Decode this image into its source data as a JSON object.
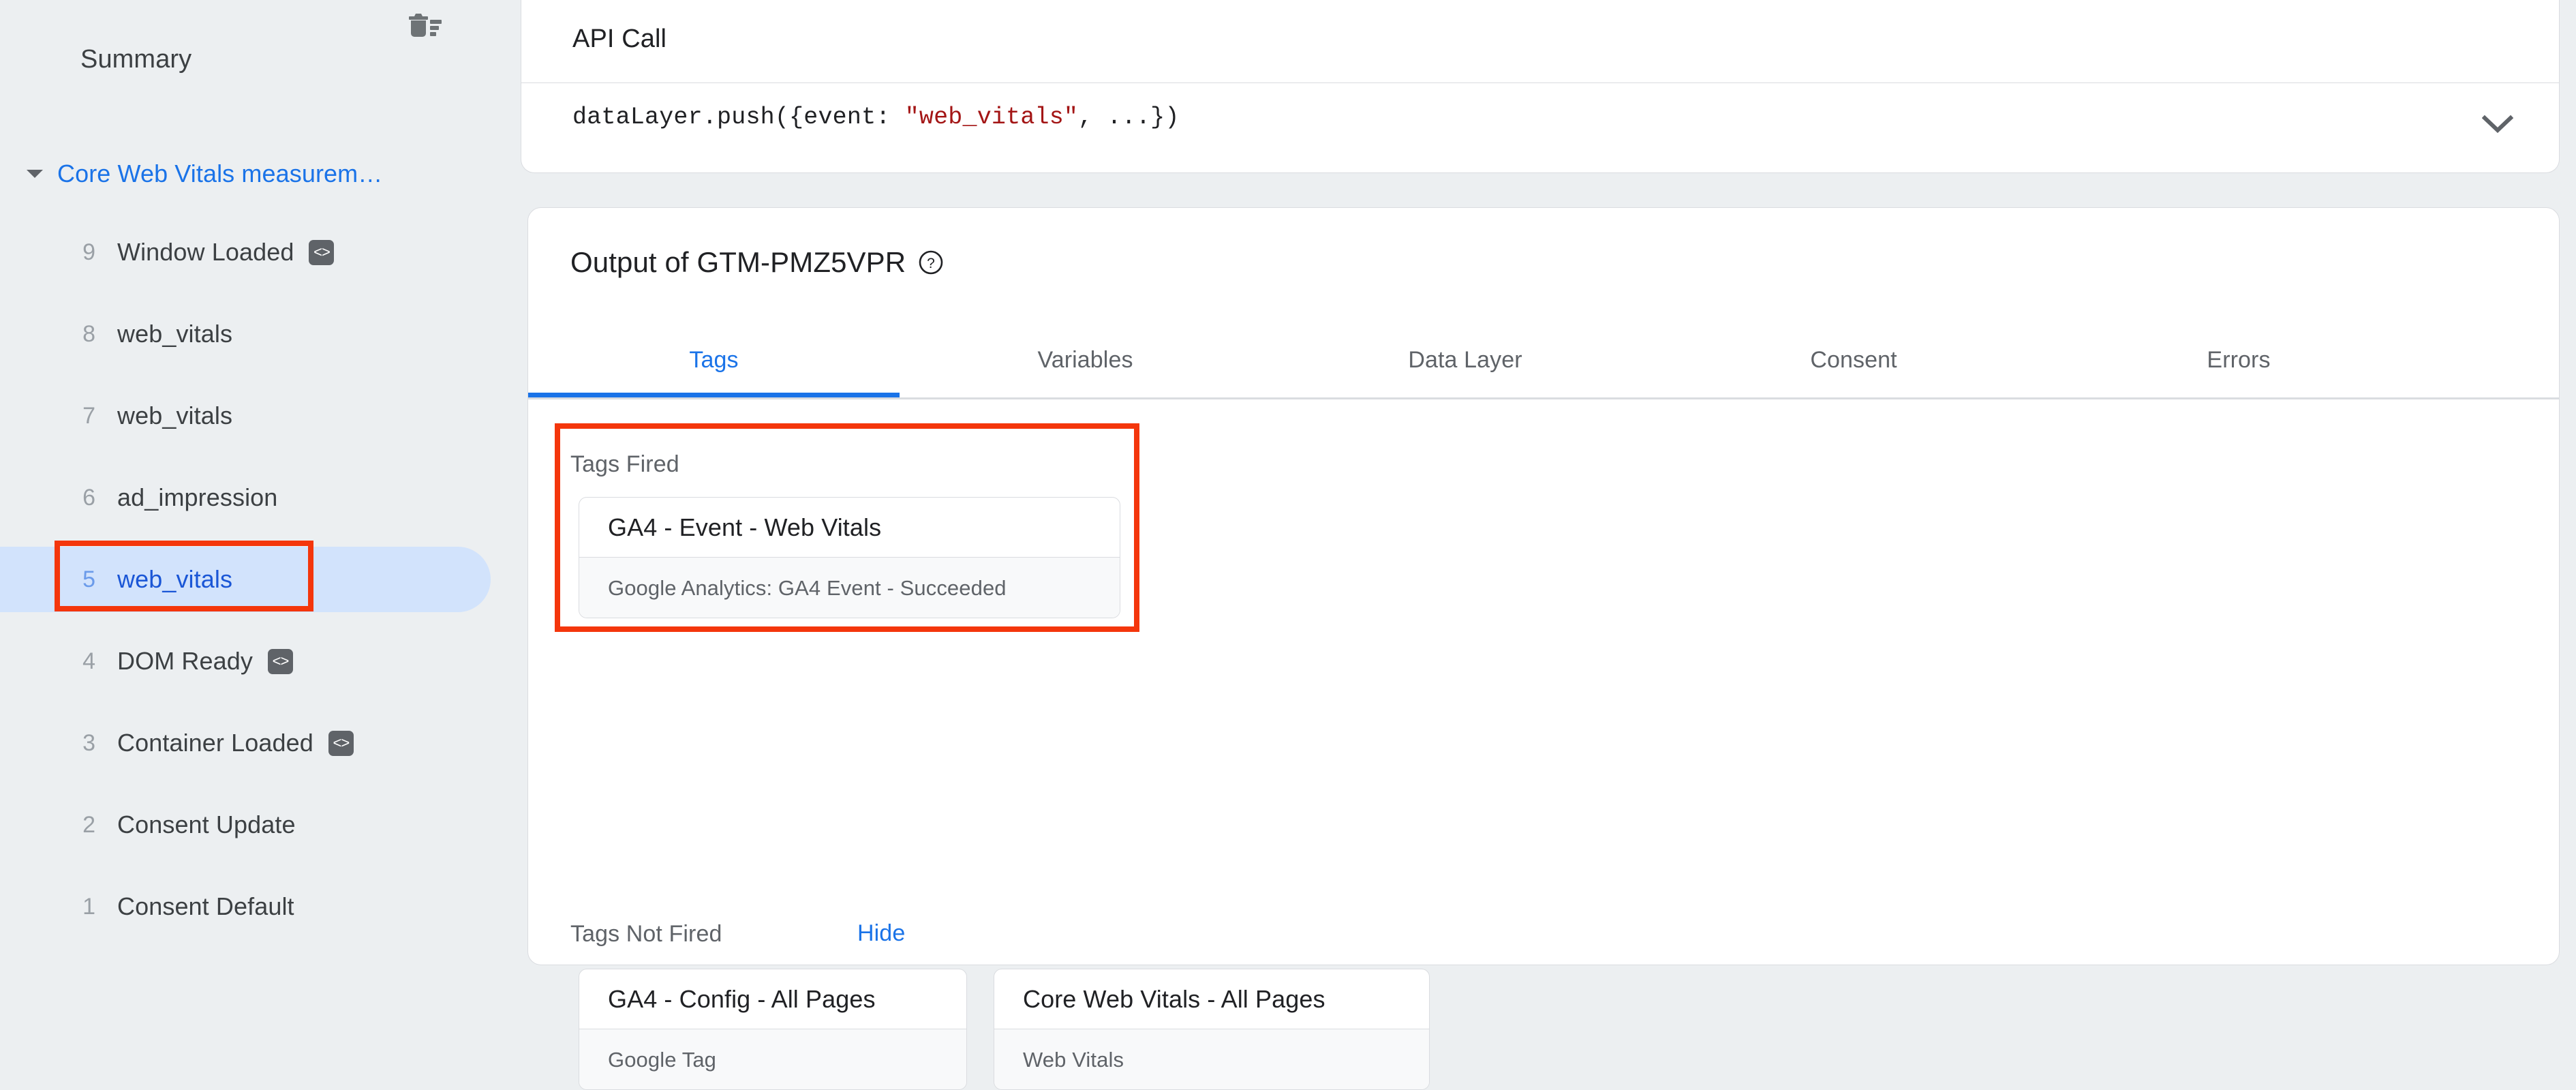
{
  "sidebar": {
    "summary_label": "Summary",
    "delete_icon": "delete-sweep-icon",
    "group": {
      "label": "Core Web Vitals measurem…",
      "caret_icon": "caret-down-icon",
      "expanded": true
    },
    "events": [
      {
        "index": "9",
        "name": "Window Loaded",
        "badge": "<>",
        "has_badge": true,
        "selected": false
      },
      {
        "index": "8",
        "name": "web_vitals",
        "badge": "",
        "has_badge": false,
        "selected": false
      },
      {
        "index": "7",
        "name": "web_vitals",
        "badge": "",
        "has_badge": false,
        "selected": false
      },
      {
        "index": "6",
        "name": "ad_impression",
        "badge": "",
        "has_badge": false,
        "selected": false
      },
      {
        "index": "5",
        "name": "web_vitals",
        "badge": "",
        "has_badge": false,
        "selected": true
      },
      {
        "index": "4",
        "name": "DOM Ready",
        "badge": "<>",
        "has_badge": true,
        "selected": false
      },
      {
        "index": "3",
        "name": "Container Loaded",
        "badge": "<>",
        "has_badge": true,
        "selected": false
      },
      {
        "index": "2",
        "name": "Consent Update",
        "badge": "",
        "has_badge": false,
        "selected": false
      },
      {
        "index": "1",
        "name": "Consent Default",
        "badge": "",
        "has_badge": false,
        "selected": false
      }
    ]
  },
  "api_call": {
    "title": "API Call",
    "code_prefix": "dataLayer.push({event: ",
    "code_string": "\"web_vitals\"",
    "code_suffix": ", ...})",
    "expand_icon": "chevron-down-icon"
  },
  "output": {
    "title": "Output of GTM-PMZ5VPR",
    "help_icon": "help-circle-icon",
    "tabs": [
      {
        "label": "Tags",
        "active": true
      },
      {
        "label": "Variables",
        "active": false
      },
      {
        "label": "Data Layer",
        "active": false
      },
      {
        "label": "Consent",
        "active": false
      },
      {
        "label": "Errors",
        "active": false
      }
    ],
    "tags_fired": {
      "heading": "Tags Fired",
      "tags": [
        {
          "name": "GA4 - Event - Web Vitals",
          "status": "Google Analytics: GA4 Event - Succeeded"
        }
      ]
    },
    "tags_not_fired": {
      "heading": "Tags Not Fired",
      "hide_label": "Hide",
      "tags": [
        {
          "name": "GA4 - Config - All Pages",
          "status": "Google Tag"
        },
        {
          "name": "Core Web Vitals - All Pages",
          "status": "Web Vitals"
        }
      ]
    }
  },
  "colors": {
    "accent_blue": "#1a73e8",
    "selected_pill": "#d2e3fc",
    "annotation_red": "#f4360c",
    "page_bg": "#eceff1",
    "text_primary": "#202124",
    "text_secondary": "#5f6368"
  }
}
